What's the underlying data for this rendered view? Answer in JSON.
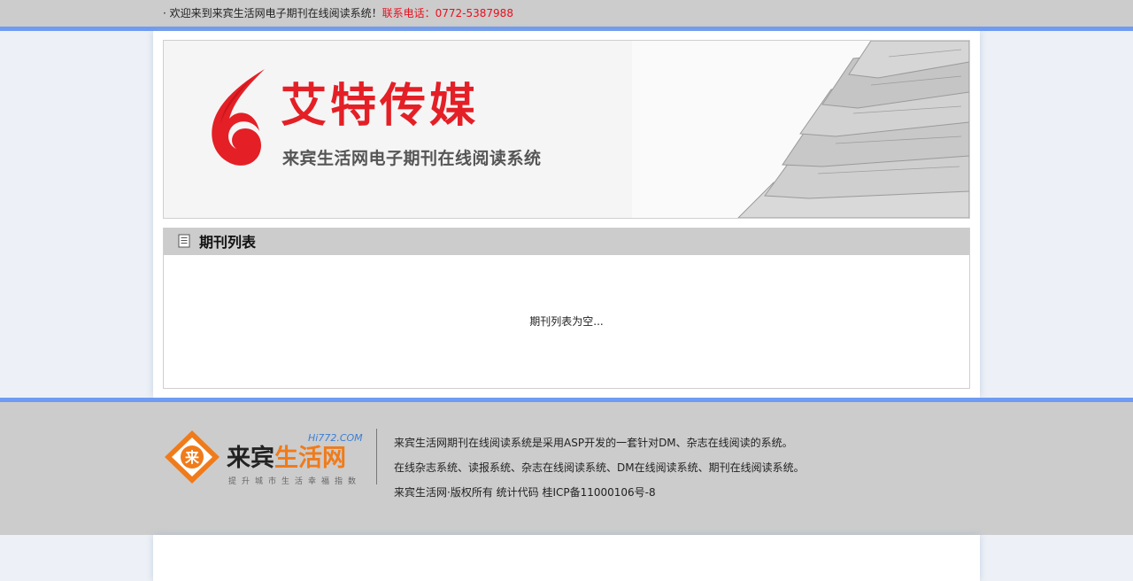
{
  "topbar": {
    "welcome": "· 欢迎来到来宾生活网电子期刊在线阅读系统！",
    "phone": "联系电话：0772-5387988"
  },
  "banner": {
    "title": "艾特传媒",
    "subtitle": "来宾生活网电子期刊在线阅读系统",
    "brand_color": "#e41f26"
  },
  "panel": {
    "title": "期刊列表",
    "icon": "document-icon",
    "empty_message": "期刊列表为空..."
  },
  "footer": {
    "logo": {
      "name_part1": "来宾",
      "name_part2": "生活网",
      "domain": "Hi772.COM",
      "slogan": "提升城市生活幸福指数"
    },
    "lines": [
      "来宾生活网期刊在线阅读系统是采用ASP开发的一套针对DM、杂志在线阅读的系统。",
      "在线杂志系统、读报系统、杂志在线阅读系统、DM在线阅读系统、期刊在线阅读系统。",
      "来宾生活网·版权所有 统计代码 桂ICP备11000106号-8"
    ]
  },
  "colors": {
    "accent_line": "#6f9bf2",
    "bar_gray": "#cccccc",
    "phone_red": "#e8101e",
    "logo_orange": "#f07b1a"
  }
}
